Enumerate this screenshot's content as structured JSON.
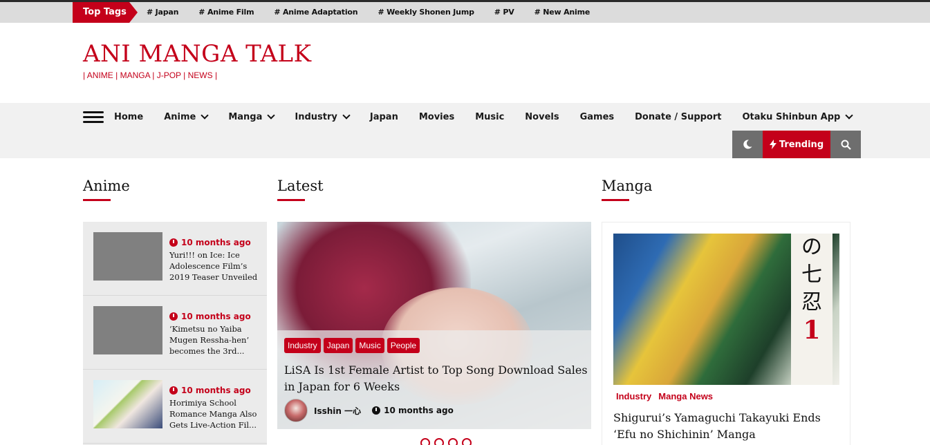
{
  "topbar": {
    "label": "Top Tags",
    "tags": [
      "# Japan",
      "# Anime Film",
      "# Anime Adaptation",
      "# Weekly Shonen Jump",
      "# PV",
      "# New Anime"
    ]
  },
  "header": {
    "title": "ANI MANGA TALK",
    "tagline": "| ANIME | MANGA | J-POP | NEWS |"
  },
  "nav": {
    "items": [
      {
        "label": "Home",
        "dropdown": false
      },
      {
        "label": "Anime",
        "dropdown": true
      },
      {
        "label": "Manga",
        "dropdown": true
      },
      {
        "label": "Industry",
        "dropdown": true
      },
      {
        "label": "Japan",
        "dropdown": false
      },
      {
        "label": "Movies",
        "dropdown": false
      },
      {
        "label": "Music",
        "dropdown": false
      },
      {
        "label": "Novels",
        "dropdown": false
      },
      {
        "label": "Games",
        "dropdown": false
      },
      {
        "label": "Donate / Support",
        "dropdown": false
      },
      {
        "label": "Otaku Shinbun App",
        "dropdown": true
      }
    ],
    "trending_label": "Trending"
  },
  "sections": {
    "anime": "Anime",
    "latest": "Latest",
    "manga": "Manga"
  },
  "anime_list": [
    {
      "time": "10 months ago",
      "title": "Yuri!!! on Ice: Ice Adolescence Film’s 2019 Teaser Unveiled"
    },
    {
      "time": "10 months ago",
      "title": "‘Kimetsu no Yaiba Mugen Ressha-hen’ becomes the 3rd..."
    },
    {
      "time": "10 months ago",
      "title": "Horimiya School Romance Manga Also Gets Live-Action Fil..."
    }
  ],
  "latest": {
    "categories": [
      "Industry",
      "Japan",
      "Music",
      "People"
    ],
    "title": "LiSA Is 1st Female Artist to Top Song Download Sales in Japan for 6 Weeks",
    "author": "Isshin 一心",
    "time": "10 months ago"
  },
  "manga": {
    "categories": [
      "Industry",
      "Manga News"
    ],
    "title": "Shigurui’s Yamaguchi Takayuki Ends ‘Efu no Shichinin’ Manga",
    "cover_text": [
      "の",
      "七",
      "忍",
      "1"
    ]
  },
  "colors": {
    "accent": "#c4001a",
    "tool_gray": "#6e6e6e",
    "nav_bg": "#f1f1f1"
  }
}
